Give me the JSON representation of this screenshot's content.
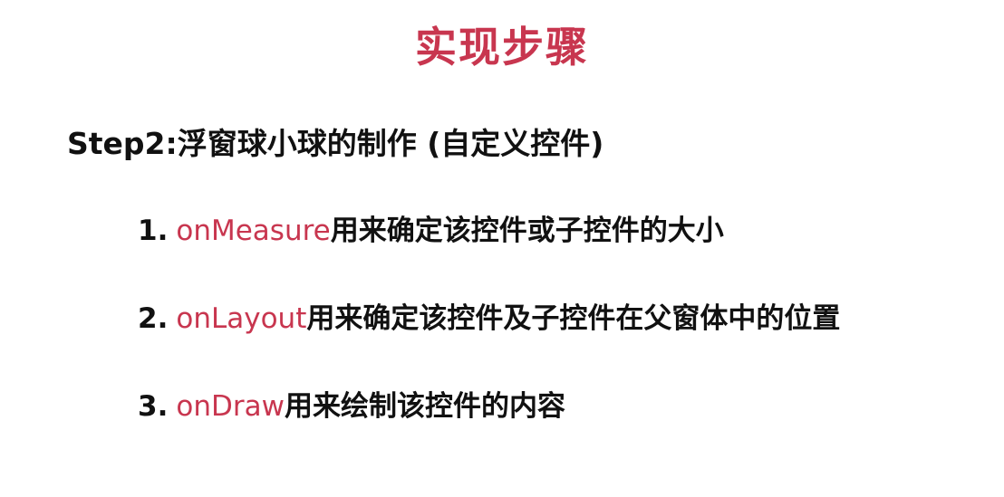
{
  "title": "实现步骤",
  "heading": "Step2:浮窗球小球的制作 (自定义控件)",
  "steps": [
    {
      "number": "1.",
      "method": "onMeasure",
      "description": "用来确定该控件或子控件的大小"
    },
    {
      "number": "2.",
      "method": "onLayout",
      "description": "用来确定该控件及子控件在父窗体中的位置"
    },
    {
      "number": "3.",
      "method": "onDraw",
      "description": "用来绘制该控件的内容"
    }
  ],
  "colors": {
    "accent": "#c8364f",
    "text": "#111111",
    "background": "#ffffff"
  }
}
